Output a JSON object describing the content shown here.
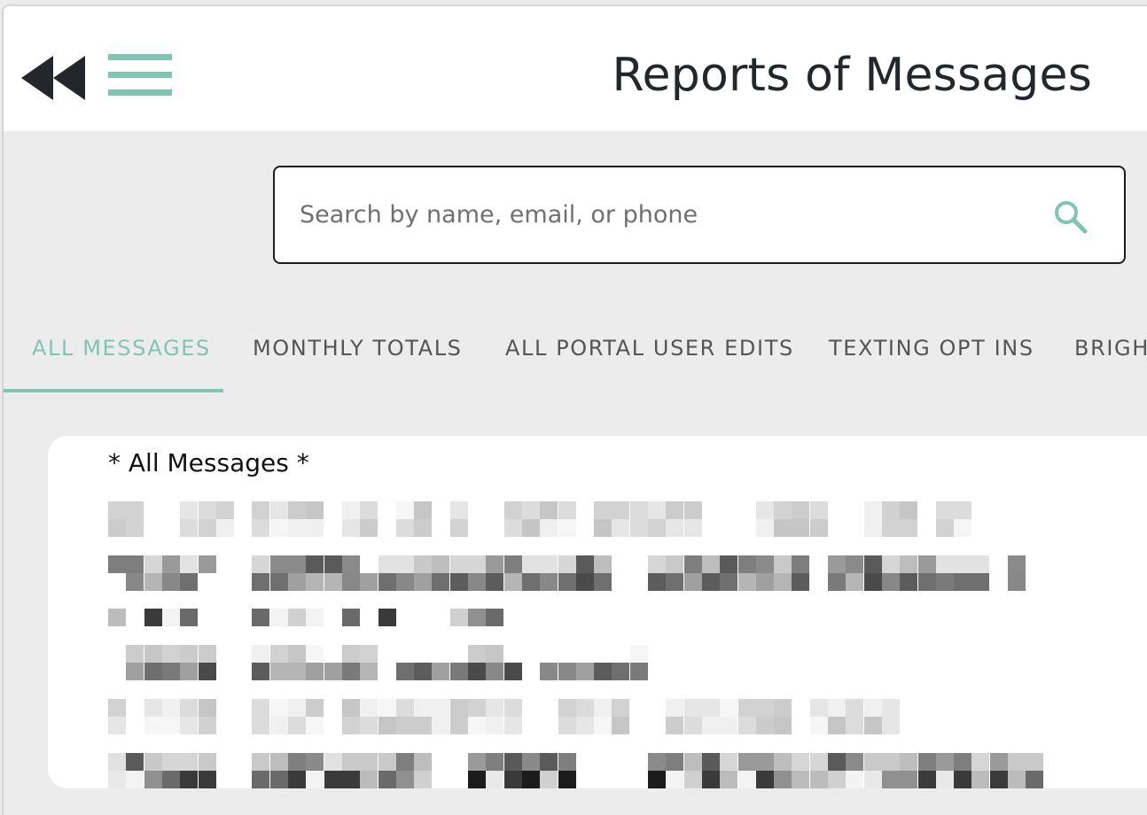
{
  "header": {
    "title": "Reports of Messages",
    "back_icon": "double-chevron-left-icon",
    "menu_icon": "hamburger-menu-icon",
    "menu_color": "#80c5b4"
  },
  "search": {
    "placeholder": "Search by name, email, or phone",
    "value": "",
    "icon": "search-icon",
    "icon_color": "#80c5b4"
  },
  "tabs": [
    {
      "label": "ALL MESSAGES",
      "active": true
    },
    {
      "label": "MONTHLY TOTALS",
      "active": false
    },
    {
      "label": "ALL PORTAL USER EDITS",
      "active": false
    },
    {
      "label": "TEXTING OPT INS",
      "active": false
    },
    {
      "label": "BRIGHT",
      "active": false
    }
  ],
  "card": {
    "title": "* All Messages *"
  },
  "colors": {
    "accent": "#80c5b4",
    "background": "#ececec",
    "surface": "#ffffff",
    "text": "#23272b"
  }
}
